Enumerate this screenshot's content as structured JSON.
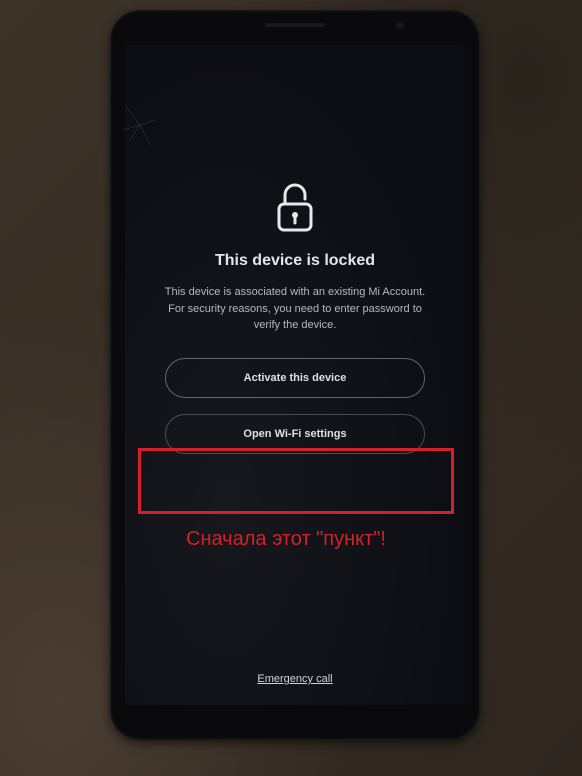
{
  "lock_screen": {
    "title": "This device is locked",
    "description": "This device is associated with an existing Mi Account. For security reasons, you need to enter password to verify the device.",
    "activate_label": "Activate this device",
    "wifi_label": "Open Wi-Fi settings",
    "emergency_label": "Emergency call"
  },
  "annotation": {
    "text": "Сначала этот \"пункт\"!",
    "highlight_color": "#d4202a"
  }
}
